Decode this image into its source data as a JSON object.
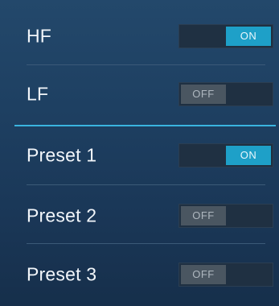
{
  "rows": [
    {
      "label": "HF",
      "state": "on",
      "toggle_text": "ON"
    },
    {
      "label": "LF",
      "state": "off",
      "toggle_text": "OFF"
    },
    {
      "label": "Preset 1",
      "state": "on",
      "toggle_text": "ON"
    },
    {
      "label": "Preset 2",
      "state": "off",
      "toggle_text": "OFF"
    },
    {
      "label": "Preset 3",
      "state": "off",
      "toggle_text": "OFF"
    }
  ],
  "colors": {
    "accent": "#1ea0c8",
    "section_divider": "#3ab4de",
    "off_thumb": "#4a5661",
    "background": "#1e4062"
  }
}
